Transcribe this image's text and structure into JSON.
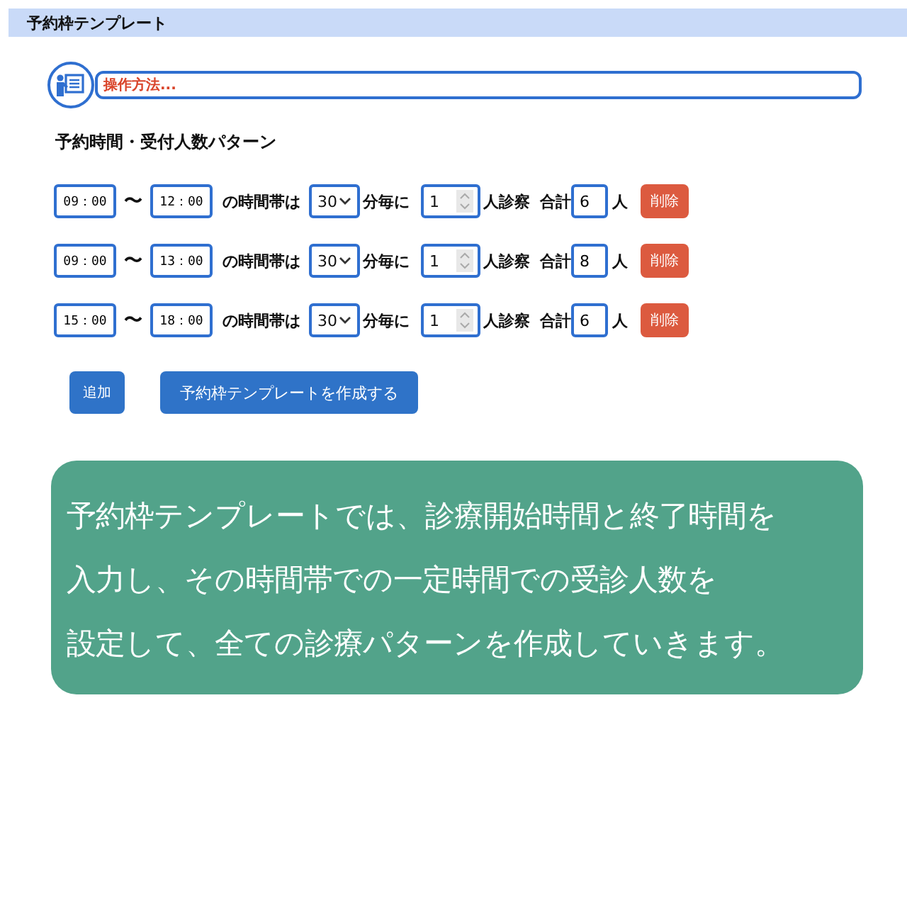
{
  "header": {
    "title": "予約枠テンプレート"
  },
  "help": {
    "label": "操作方法..."
  },
  "section_title": "予約時間・受付人数パターン",
  "rows": [
    {
      "start": "09：00",
      "separator": "〜",
      "end": "12：00",
      "label_period": "の時間帯は",
      "interval": "30",
      "label_interval": "分毎に",
      "patients": "1",
      "label_patients": "人診察",
      "label_total": "合計",
      "total": "6",
      "label_unit": "人",
      "delete": "削除"
    },
    {
      "start": "09：00",
      "separator": "〜",
      "end": "13：00",
      "label_period": "の時間帯は",
      "interval": "30",
      "label_interval": "分毎に",
      "patients": "1",
      "label_patients": "人診察",
      "label_total": "合計",
      "total": "8",
      "label_unit": "人",
      "delete": "削除"
    },
    {
      "start": "15：00",
      "separator": "〜",
      "end": "18：00",
      "label_period": "の時間帯は",
      "interval": "30",
      "label_interval": "分毎に",
      "patients": "1",
      "label_patients": "人診察",
      "label_total": "合計",
      "total": "6",
      "label_unit": "人",
      "delete": "削除"
    }
  ],
  "buttons": {
    "add": "追加",
    "create": "予約枠テンプレートを作成する"
  },
  "note_lines": [
    "予約枠テンプレートでは、診療開始時間と終了時間を",
    "入力し、その時間帯での一定時間での受診人数を",
    "設定して、全ての診療パターンを作成していきます。"
  ]
}
